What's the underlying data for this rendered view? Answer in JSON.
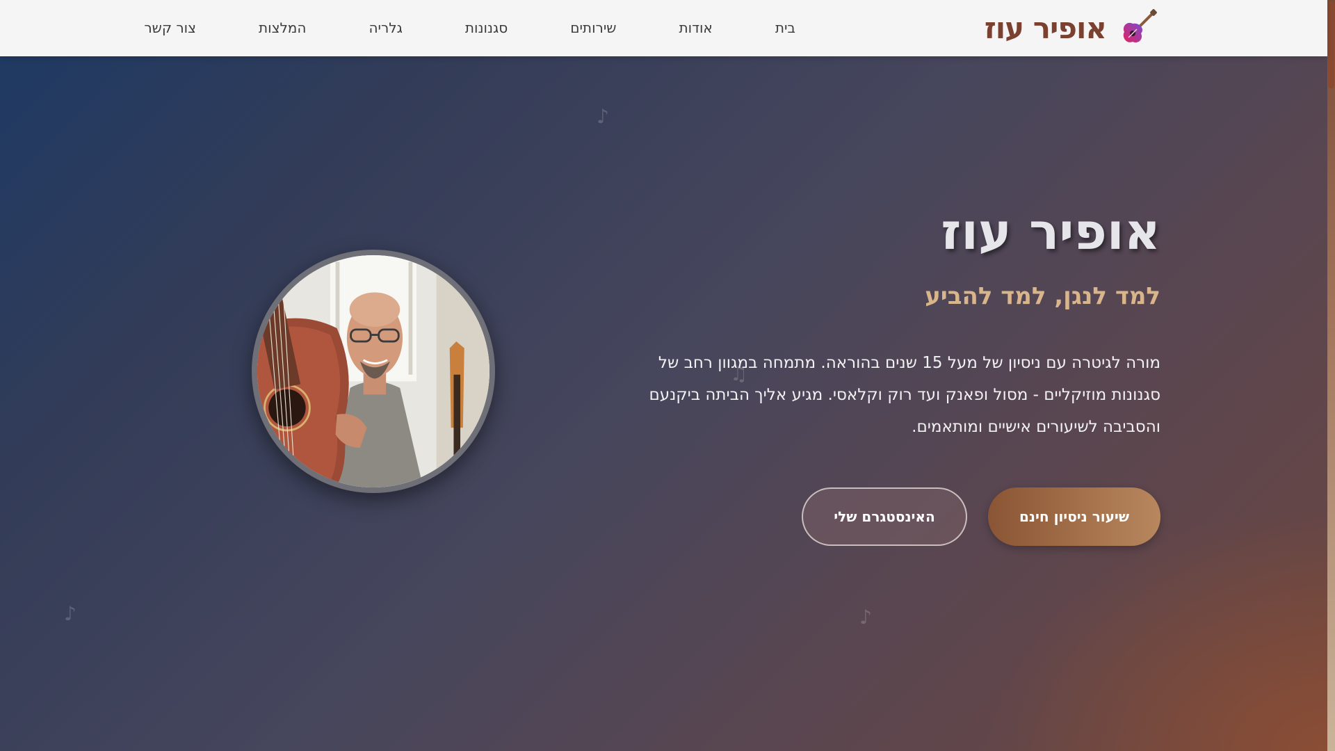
{
  "brand": {
    "name": "אופיר עוז",
    "icon": "guitar-icon"
  },
  "nav": {
    "items": [
      {
        "label": "בית"
      },
      {
        "label": "אודות"
      },
      {
        "label": "שירותים"
      },
      {
        "label": "סגנונות"
      },
      {
        "label": "גלריה"
      },
      {
        "label": "המלצות"
      },
      {
        "label": "צור קשר"
      }
    ]
  },
  "hero": {
    "title": "אופיר עוז",
    "subtitle": "למד לנגן, למד להביע",
    "description": "מורה לגיטרה עם ניסיון של מעל 15 שנים בהוראה. מתמחה במגוון רחב של סגנונות מוזיקליים - מסול ופאנק ועד רוק וקלאסי. מגיע אליך הביתה ביקנעם והסביבה לשיעורים אישיים ומותאמים.",
    "primary_button": "שיעור ניסיון חינם",
    "secondary_button": "האינסטגרם שלי",
    "avatar_icon": "teacher-photo"
  },
  "colors": {
    "brand": "#7a4030",
    "accent": "#b8875e",
    "subtitle": "#d9b58c"
  }
}
